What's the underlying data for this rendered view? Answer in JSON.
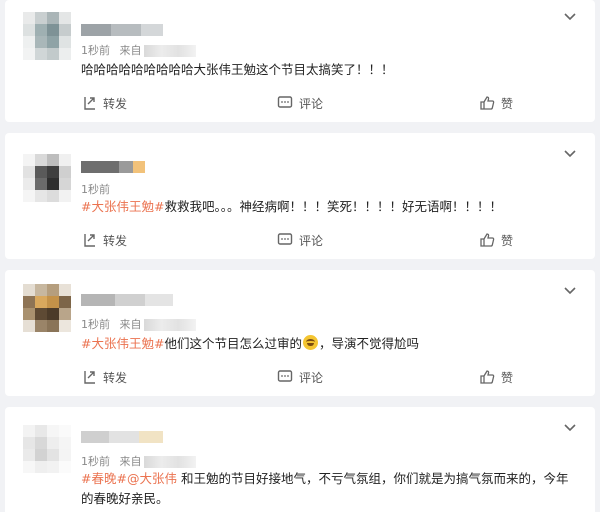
{
  "comments": [
    {
      "time": "1秒前",
      "source_prefix": "来自",
      "text": "哈哈哈哈哈哈哈哈哈大张伟王勉这个节目太搞笑了！！！",
      "actions": {
        "repost": "转发",
        "comment": "评论",
        "like": "赞"
      }
    },
    {
      "time": "1秒前",
      "hashtag": "#大张伟王勉#",
      "text": "救救我吧。。。神经病啊！！！笑死！！！！好无语啊！！！！",
      "actions": {
        "repost": "转发",
        "comment": "评论",
        "like": "赞"
      }
    },
    {
      "time": "1秒前",
      "source_prefix": "来自",
      "hashtag": "#大张伟王勉#",
      "text_before_emoji": "他们这个节目怎么过审的",
      "emoji": "laughing-crying-emoji",
      "text_after_emoji": "，导演不觉得尬吗",
      "actions": {
        "repost": "转发",
        "comment": "评论",
        "like": "赞"
      }
    },
    {
      "time": "1秒前",
      "source_prefix": "来自",
      "hashtag": "#春晚#",
      "mention": "@大张伟",
      "text_line1": " 和王勉的节目好接地气，不亏气氛组，你们就是为搞气氛而来的，今年",
      "text_line2": "的春晚好亲民。"
    }
  ],
  "colors": {
    "accent": "#eb7350",
    "text": "#222222",
    "meta": "#8a8a8a",
    "background": "#f1f2f5"
  }
}
